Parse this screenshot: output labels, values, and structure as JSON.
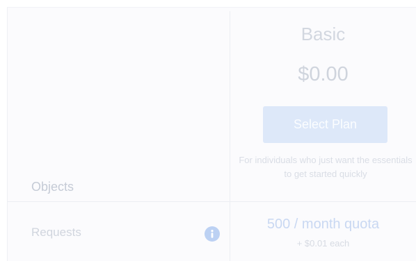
{
  "colors": {
    "panel_background": "#fbfbfd",
    "divider": "#eceef3",
    "button_background": "#dde8f9",
    "accent": "#bcd1f3",
    "muted_text": "#d0d5de"
  },
  "plan": {
    "name": "Basic",
    "price": "$0.00",
    "button_label": "Select Plan",
    "description": "For individuals who just want the essentials to get started quickly"
  },
  "features": {
    "section_label": "Objects",
    "rows": [
      {
        "label": "Requests",
        "info_icon": "info-icon",
        "quota": "500 / month quota",
        "overage": "+ $0.01 each"
      }
    ]
  }
}
